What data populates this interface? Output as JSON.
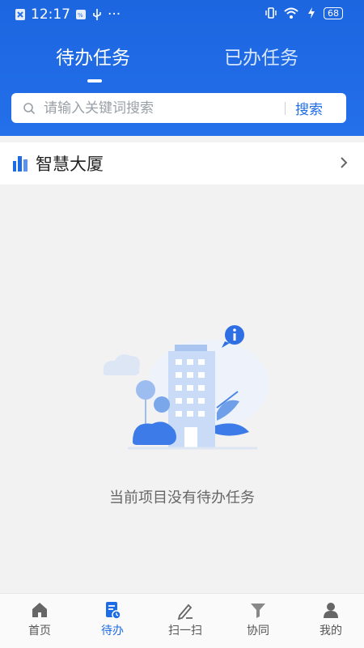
{
  "status_bar": {
    "time": "12:17",
    "extra": "···",
    "battery": "68"
  },
  "tabs": [
    {
      "label": "待办任务",
      "active": true
    },
    {
      "label": "已办任务",
      "active": false
    }
  ],
  "search": {
    "placeholder": "请输入关键词搜索",
    "button_label": "搜索"
  },
  "project": {
    "name": "智慧大厦"
  },
  "empty_state": {
    "message": "当前项目没有待办任务"
  },
  "bottom_nav": [
    {
      "label": "首页",
      "icon": "home-icon",
      "active": false
    },
    {
      "label": "待办",
      "icon": "todo-icon",
      "active": true
    },
    {
      "label": "扫一扫",
      "icon": "scan-icon",
      "active": false
    },
    {
      "label": "协同",
      "icon": "collaborate-icon",
      "active": false
    },
    {
      "label": "我的",
      "icon": "profile-icon",
      "active": false
    }
  ],
  "colors": {
    "primary": "#1e6be6",
    "header": "#2470ea",
    "background": "#f2f2f2"
  }
}
